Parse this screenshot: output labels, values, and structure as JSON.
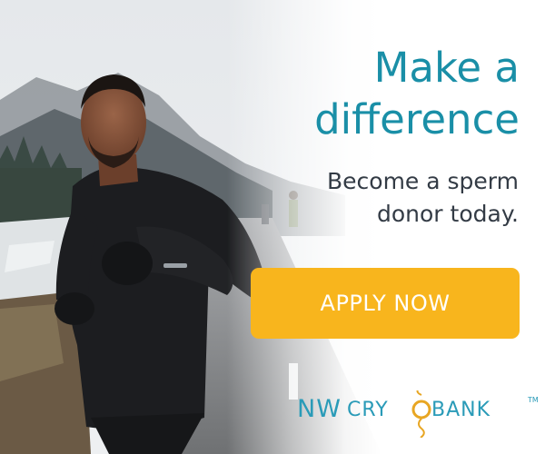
{
  "ad": {
    "headline": [
      "Make a",
      "difference"
    ],
    "subheadline": [
      "Become a sperm",
      "donor today."
    ],
    "cta_label": "APPLY NOW",
    "brand": {
      "part1": "NW",
      "part2": "CRY",
      "part3": "BANK",
      "trademark": "TM"
    }
  },
  "colors": {
    "headline": "#1a8fa7",
    "subheadline": "#333b45",
    "button_bg": "#f8b51d",
    "button_text": "#ffffff",
    "brand_teal": "#2a9bb8",
    "brand_gold": "#e8a623"
  },
  "photo": {
    "subject": "young man in black running clothes jogging on a wet road",
    "scenery": "misty snowy mountains, evergreen forest, runners in the background"
  }
}
